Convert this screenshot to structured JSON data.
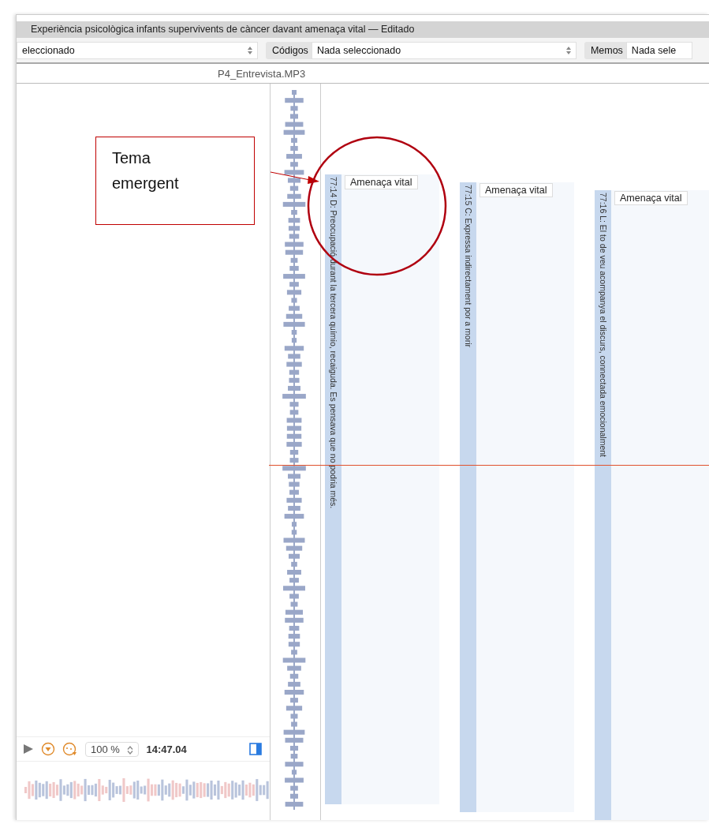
{
  "window": {
    "title": "Experiència psicològica infants supervivents de càncer davant amenaça vital — Editado"
  },
  "toolbar": {
    "documents_value": "eleccionado",
    "codes_label": "Códigos",
    "codes_value": "Nada seleccionado",
    "memos_label": "Memos",
    "memos_value": "Nada sele"
  },
  "document": {
    "name": "P4_Entrevista.MP3"
  },
  "quotations": [
    {
      "text": "77:14 D: Preocupació durant la tercera químio, recaiguda. Es pensava que no podria més.",
      "code": "Amenaça vital"
    },
    {
      "text": "77:15 C: Expressa indirectament por a morir",
      "code": "Amenaça vital"
    },
    {
      "text": "77:16 L: El to de veu acompanya el discurs, connectada emocionalment",
      "code": "Amenaça vital"
    }
  ],
  "player": {
    "zoom": "100 %",
    "time": "14:47.04"
  },
  "annotation": {
    "text": "Tema emergent"
  }
}
